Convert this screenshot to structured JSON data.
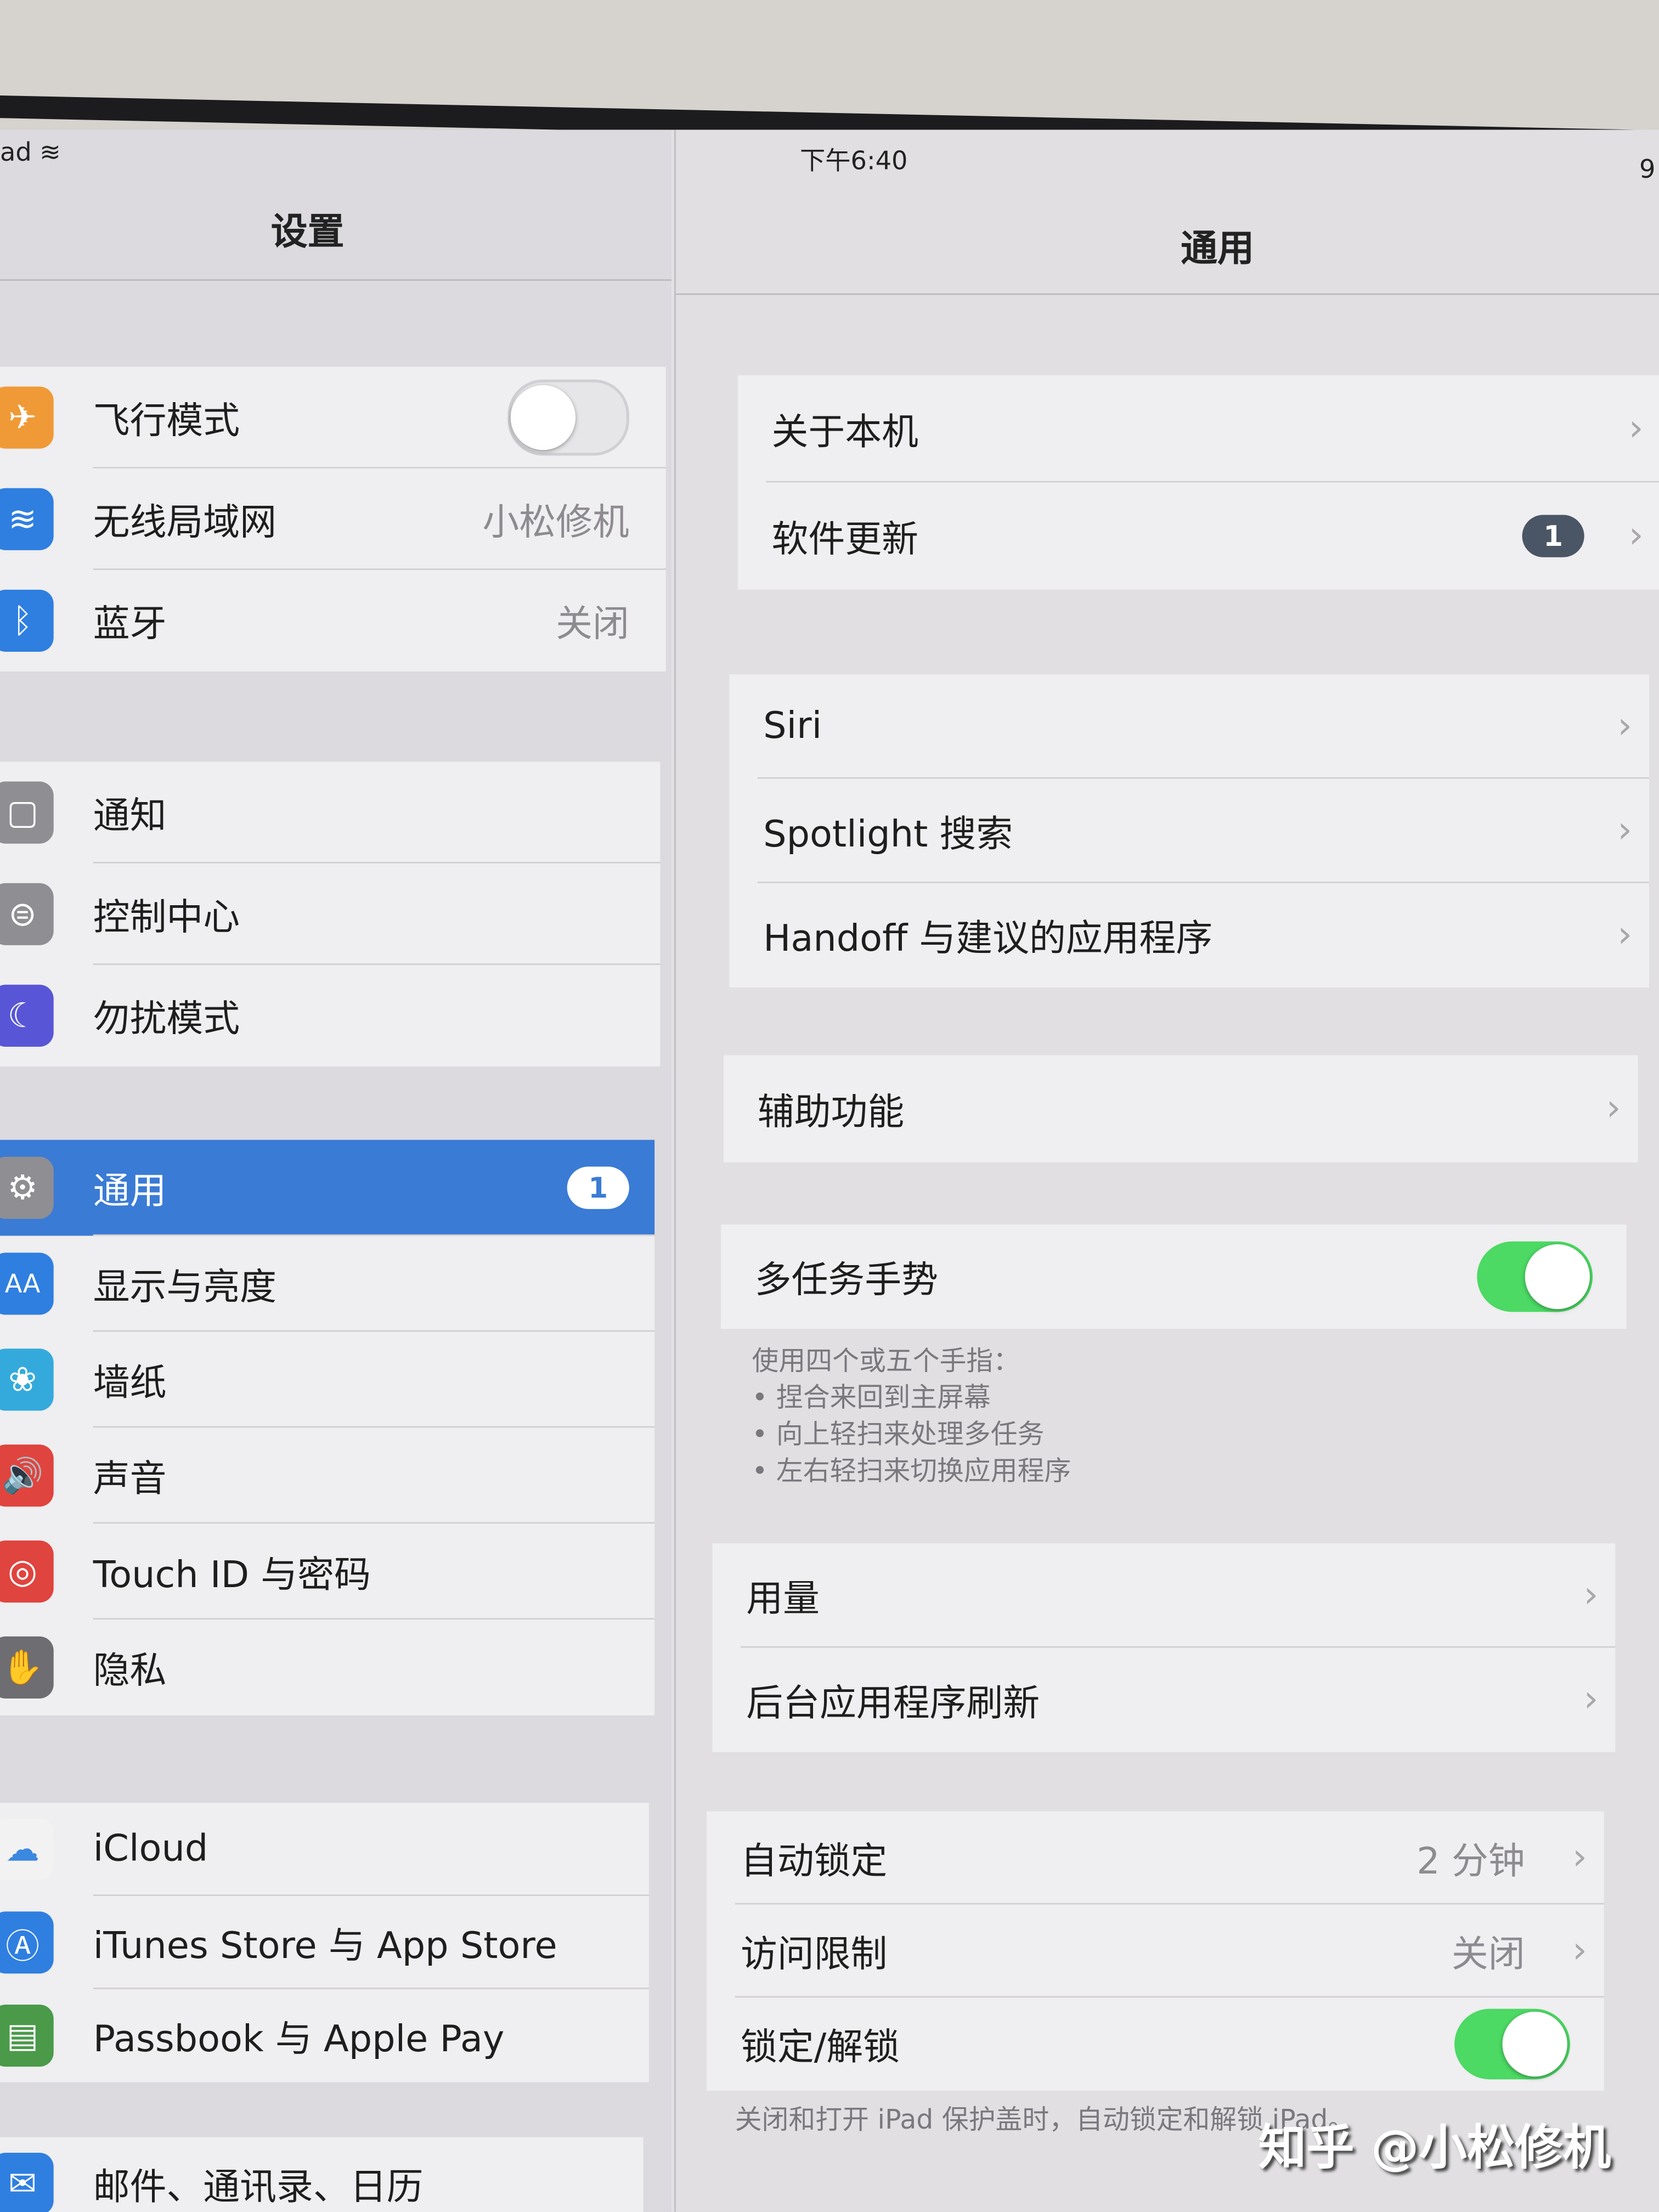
{
  "status": {
    "carrier": "ad",
    "time": "下午6:40",
    "battery": "9"
  },
  "left": {
    "title": "设置",
    "groups": [
      [
        {
          "label": "飞行模式",
          "icon": "airplane-icon",
          "glyph": "✈",
          "color": "#f09a37",
          "toggle": false
        },
        {
          "label": "无线局域网",
          "icon": "wifi-icon",
          "glyph": "≋",
          "color": "#2f7fe0",
          "value": "小松修机"
        },
        {
          "label": "蓝牙",
          "icon": "bluetooth-icon",
          "glyph": "ᛒ",
          "color": "#2f7fe0",
          "value": "关闭"
        }
      ],
      [
        {
          "label": "通知",
          "icon": "notifications-icon",
          "glyph": "▢",
          "color": "#8e8e93"
        },
        {
          "label": "控制中心",
          "icon": "control-center-icon",
          "glyph": "⊜",
          "color": "#8e8e93"
        },
        {
          "label": "勿扰模式",
          "icon": "moon-icon",
          "glyph": "☾",
          "color": "#5856d6"
        }
      ],
      [
        {
          "label": "通用",
          "icon": "gear-icon",
          "glyph": "⚙",
          "color": "#8e8e93",
          "badge": "1",
          "selected": true
        },
        {
          "label": "显示与亮度",
          "icon": "display-icon",
          "glyph": "AA",
          "color": "#2f7fe0"
        },
        {
          "label": "墙纸",
          "icon": "wallpaper-icon",
          "glyph": "❀",
          "color": "#34aadc"
        },
        {
          "label": "声音",
          "icon": "sound-icon",
          "glyph": "🔊",
          "color": "#e0443e"
        },
        {
          "label": "Touch ID 与密码",
          "icon": "fingerprint-icon",
          "glyph": "◎",
          "color": "#e0443e"
        },
        {
          "label": "隐私",
          "icon": "hand-icon",
          "glyph": "✋",
          "color": "#6d6d72"
        }
      ],
      [
        {
          "label": "iCloud",
          "icon": "icloud-icon",
          "glyph": "☁",
          "color": "#f2f2f2",
          "fg": "#3b88e0"
        },
        {
          "label": "iTunes Store 与 App Store",
          "icon": "app-store-icon",
          "glyph": "Ⓐ",
          "color": "#2f7fe0"
        },
        {
          "label": "Passbook 与 Apple Pay",
          "icon": "wallet-icon",
          "glyph": "▤",
          "color": "#4a9a4a"
        }
      ],
      [
        {
          "label": "邮件、通讯录、日历",
          "icon": "mail-icon",
          "glyph": "✉",
          "color": "#2f7fe0"
        }
      ]
    ]
  },
  "right": {
    "title": "通用",
    "groups": [
      [
        {
          "label": "关于本机",
          "chevron": true
        },
        {
          "label": "软件更新",
          "badge": "1",
          "chevron": true
        }
      ],
      [
        {
          "label": "Siri",
          "chevron": true
        },
        {
          "label": "Spotlight 搜索",
          "chevron": true
        },
        {
          "label": "Handoff 与建议的应用程序",
          "chevron": true
        }
      ],
      [
        {
          "label": "辅助功能",
          "chevron": true
        }
      ],
      [
        {
          "label": "多任务手势",
          "toggle": true
        }
      ],
      [
        {
          "label": "用量",
          "chevron": true
        },
        {
          "label": "后台应用程序刷新",
          "chevron": true
        }
      ],
      [
        {
          "label": "自动锁定",
          "value": "2 分钟",
          "chevron": true
        },
        {
          "label": "访问限制",
          "value": "关闭",
          "chevron": true
        },
        {
          "label": "锁定/解锁",
          "toggle": true
        }
      ]
    ],
    "multitask_footer": [
      "使用四个或五个手指：",
      "• 捏合来回到主屏幕",
      "• 向上轻扫来处理多任务",
      "• 左右轻扫来切换应用程序"
    ],
    "lock_footer": "关闭和打开 iPad 保护盖时，自动锁定和解锁 iPad。"
  },
  "colors": {
    "selected": "#3a7bd5",
    "toggle_on": "#4cd964",
    "badge": "#4a5566"
  },
  "watermark": "知乎 @小松修机"
}
